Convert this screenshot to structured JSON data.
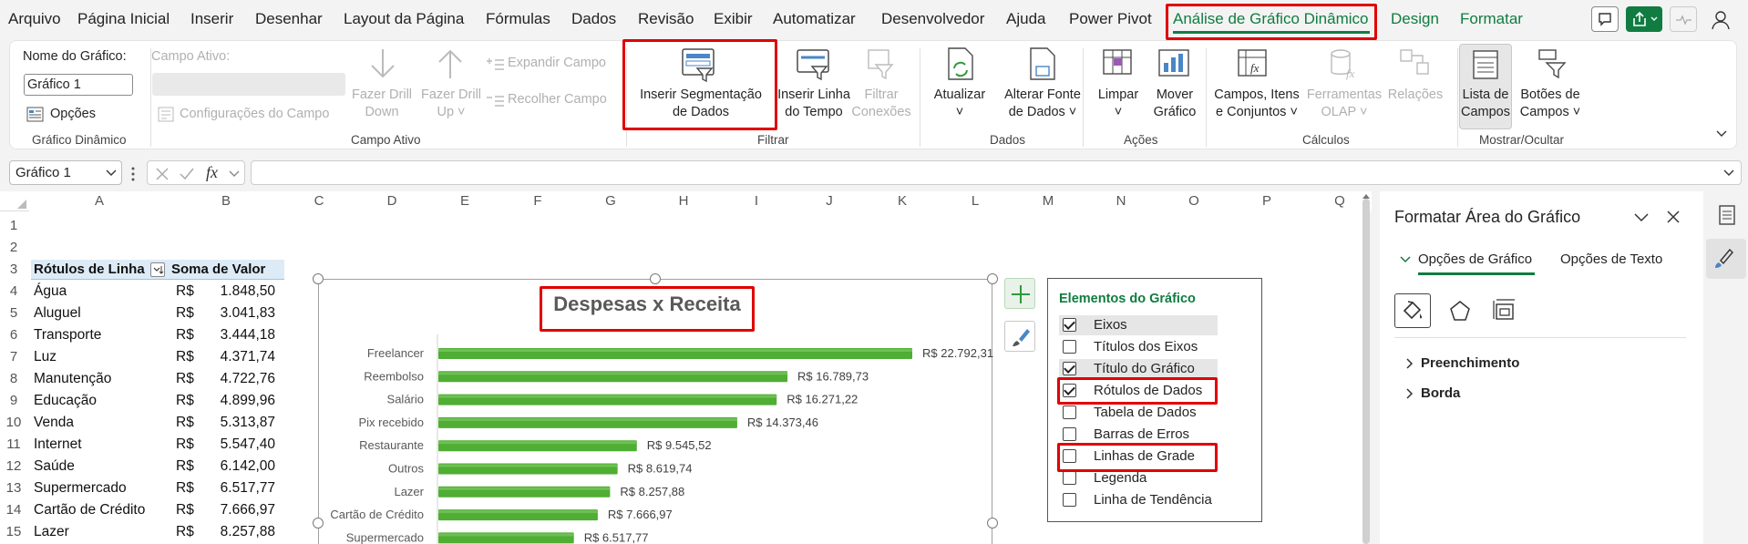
{
  "menu": {
    "tabs": [
      "Arquivo",
      "Página Inicial",
      "Inserir",
      "Desenhar",
      "Layout da Página",
      "Fórmulas",
      "Dados",
      "Revisão",
      "Exibir",
      "Automatizar",
      "Desenvolvedor",
      "Ajuda",
      "Power Pivot",
      "Análise de Gráfico Dinâmico",
      "Design",
      "Formatar"
    ]
  },
  "ribbon": {
    "chart_name_label": "Nome do Gráfico:",
    "chart_name_value": "Gráfico 1",
    "options": "Opções",
    "group_pivotchart": "Gráfico Dinâmico",
    "active_field_label": "Campo Ativo:",
    "field_settings": "Configurações do Campo",
    "drill_down": [
      "Fazer Drill",
      "Down"
    ],
    "drill_up": [
      "Fazer Drill",
      "Up ˅"
    ],
    "expand_field": "Expandir Campo",
    "collapse_field": "Recolher Campo",
    "group_active_field": "Campo Ativo",
    "insert_slicer": [
      "Inserir Segmentação",
      "de Dados"
    ],
    "insert_timeline": [
      "Inserir Linha",
      "do Tempo"
    ],
    "filter_connections": [
      "Filtrar",
      "Conexões"
    ],
    "group_filter": "Filtrar",
    "refresh": [
      "Atualizar",
      "˅"
    ],
    "change_source": [
      "Alterar Fonte",
      "de Dados ˅"
    ],
    "group_data": "Dados",
    "clear": [
      "Limpar",
      "˅"
    ],
    "move_chart": [
      "Mover",
      "Gráfico"
    ],
    "group_actions": "Ações",
    "fields_items": [
      "Campos, Itens",
      "e Conjuntos ˅"
    ],
    "olap_tools": [
      "Ferramentas",
      "OLAP ˅"
    ],
    "relationships": "Relações",
    "group_calc": "Cálculos",
    "field_list": [
      "Lista de",
      "Campos"
    ],
    "field_buttons": [
      "Botões de",
      "Campos ˅"
    ],
    "group_showhide": "Mostrar/Ocultar"
  },
  "formula_bar": {
    "name_box": "Gráfico 1",
    "fx": "fx"
  },
  "sheet": {
    "columns": [
      "A",
      "B",
      "C",
      "D",
      "E",
      "F",
      "G",
      "H",
      "I",
      "J",
      "K",
      "L",
      "M",
      "N",
      "O",
      "P",
      "Q"
    ],
    "rows": [
      "1",
      "2",
      "3",
      "4",
      "5",
      "6",
      "7",
      "8",
      "9",
      "10",
      "11",
      "12",
      "13",
      "14",
      "15"
    ],
    "header_a": "Rótulos de Linha",
    "header_b": "Soma de Valor",
    "currency": "R$",
    "data": [
      {
        "label": "Água",
        "value": "1.848,50"
      },
      {
        "label": "Aluguel",
        "value": "3.041,83"
      },
      {
        "label": "Transporte",
        "value": "3.444,18"
      },
      {
        "label": "Luz",
        "value": "4.371,74"
      },
      {
        "label": "Manutenção",
        "value": "4.722,76"
      },
      {
        "label": "Educação",
        "value": "4.899,96"
      },
      {
        "label": "Venda",
        "value": "5.313,87"
      },
      {
        "label": "Internet",
        "value": "5.547,40"
      },
      {
        "label": "Saúde",
        "value": "6.142,00"
      },
      {
        "label": "Supermercado",
        "value": "6.517,77"
      },
      {
        "label": "Cartão de Crédito",
        "value": "7.666,97"
      },
      {
        "label": "Lazer",
        "value": "8.257,88"
      }
    ]
  },
  "chart_data": {
    "type": "bar",
    "title": "Despesas x Receita",
    "categories": [
      "Freelancer",
      "Reembolso",
      "Salário",
      "Pix recebido",
      "Restaurante",
      "Outros",
      "Lazer",
      "Cartão de Crédito",
      "Supermercado"
    ],
    "values": [
      22792.31,
      16789.73,
      16271.22,
      14373.46,
      9545.52,
      8619.74,
      8257.88,
      7666.97,
      6517.77
    ],
    "data_labels": [
      "R$ 22.792,31",
      "R$ 16.789,73",
      "R$ 16.271,22",
      "R$ 14.373,46",
      "R$ 9.545,52",
      "R$ 8.619,74",
      "R$ 8.257,88",
      "R$ 7.666,97",
      "R$ 6.517,77"
    ],
    "bar_color": "#4fae33",
    "grid": false,
    "legend": "none"
  },
  "chart_elements": {
    "title": "Elementos do Gráfico",
    "items": [
      {
        "label": "Eixos",
        "checked": true
      },
      {
        "label": "Títulos dos Eixos",
        "checked": false
      },
      {
        "label": "Título do Gráfico",
        "checked": true
      },
      {
        "label": "Rótulos de Dados",
        "checked": true
      },
      {
        "label": "Tabela de Dados",
        "checked": false
      },
      {
        "label": "Barras de Erros",
        "checked": false
      },
      {
        "label": "Linhas de Grade",
        "checked": false
      },
      {
        "label": "Legenda",
        "checked": false
      },
      {
        "label": "Linha de Tendência",
        "checked": false
      }
    ]
  },
  "format_panel": {
    "title": "Formatar Área do Gráfico",
    "tab_chart": "Opções de Gráfico",
    "tab_text": "Opções de Texto",
    "fill": "Preenchimento",
    "border": "Borda"
  },
  "colors": {
    "accent": "#107c41",
    "highlight": "#e00000",
    "pivot_header": "#ddebf7"
  }
}
